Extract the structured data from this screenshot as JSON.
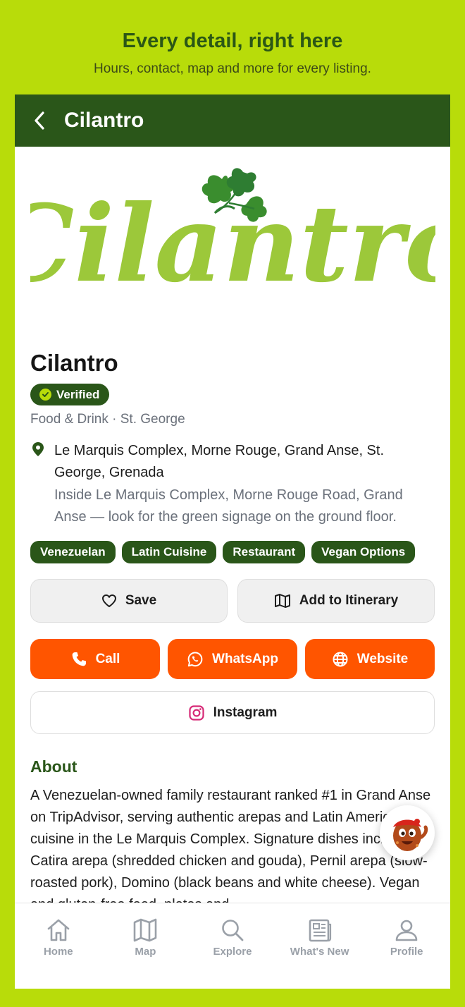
{
  "promo": {
    "title": "Every detail, right here",
    "subtitle": "Hours, contact, map and more for every listing."
  },
  "appbar": {
    "title": "Cilantro"
  },
  "logo": {
    "text": "Cilantro",
    "color": "#9cc83a"
  },
  "listing": {
    "name": "Cilantro",
    "verified_label": "Verified",
    "category": "Food & Drink · St. George",
    "address": "Le Marquis Complex, Morne Rouge, Grand Anse, St. George, Grenada",
    "directions": "Inside Le Marquis Complex, Morne Rouge Road, Grand Anse — look for the green signage on the ground floor.",
    "tags": [
      "Venezuelan",
      "Latin Cuisine",
      "Restaurant",
      "Vegan Options"
    ]
  },
  "actions": {
    "save": "Save",
    "itinerary": "Add to Itinerary",
    "call": "Call",
    "whatsapp": "WhatsApp",
    "website": "Website",
    "instagram": "Instagram"
  },
  "about": {
    "heading": "About",
    "text": "A Venezuelan-owned family restaurant ranked #1 in Grand Anse on TripAdvisor, serving authentic arepas and Latin American cuisine in the Le Marquis Complex. Signature dishes include the Catira arepa (shredded chicken and gouda), Pernil arepa (slow-roasted pork), Domino (black beans and white cheese). Vegan and gluten-free food, plates and"
  },
  "nav": [
    {
      "label": "Home",
      "icon": "home-icon"
    },
    {
      "label": "Map",
      "icon": "map-icon"
    },
    {
      "label": "Explore",
      "icon": "search-icon"
    },
    {
      "label": "What's New",
      "icon": "news-icon"
    },
    {
      "label": "Profile",
      "icon": "profile-icon"
    }
  ],
  "colors": {
    "brand_green": "#2a5619",
    "accent_lime": "#b8dc0a",
    "action_orange": "#ff5500"
  }
}
